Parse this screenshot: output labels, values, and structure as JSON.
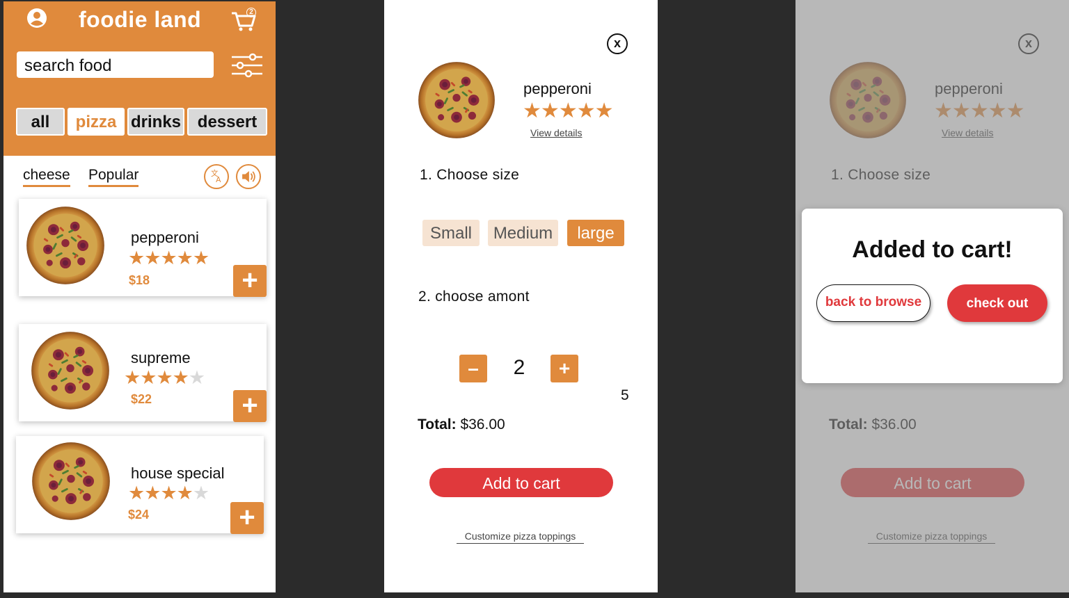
{
  "browse": {
    "app_title": "foodie land",
    "cart_count": "2",
    "search_placeholder": "search food",
    "categories": [
      "all",
      "pizza",
      "drinks",
      "dessert"
    ],
    "active_category": "pizza",
    "subtabs": [
      "cheese",
      "Popular"
    ],
    "items": [
      {
        "name": "pepperoni",
        "rating": 5,
        "price": "$18"
      },
      {
        "name": "supreme",
        "rating": 4,
        "price": "$22"
      },
      {
        "name": "house special",
        "rating": 4,
        "price": "$24"
      }
    ],
    "add_label": "+"
  },
  "detail": {
    "close_label": "x",
    "name": "pepperoni",
    "rating": 5,
    "view_details": "View details",
    "step1": "1. Choose size",
    "sizes": [
      "Small",
      "Medium",
      "large"
    ],
    "selected_size": "large",
    "step2": "2. choose amont",
    "minus_label": "–",
    "plus_label": "+",
    "quantity": "2",
    "stock_note": "5",
    "total_label": "Total:",
    "total_value": "$36.00",
    "add_to_cart": "Add to cart",
    "customize": "Customize pizza toppings"
  },
  "modal": {
    "title": "Added to cart!",
    "back_label": "back to browse",
    "checkout_label": "check out"
  },
  "colors": {
    "brand_orange": "#e08a3c",
    "cta_red": "#e0393c",
    "star_off": "#d9d9d9"
  }
}
